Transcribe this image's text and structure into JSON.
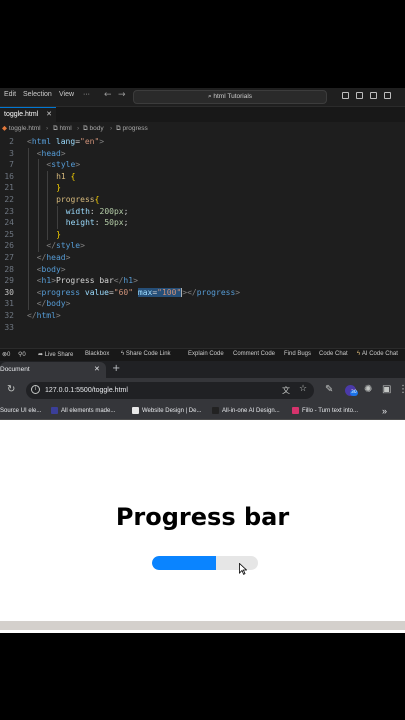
{
  "vscode": {
    "menu": [
      "Edit",
      "Selection",
      "View",
      "···"
    ],
    "search": "html Tutorials",
    "tab": {
      "filename": "toggle.html",
      "close": "✕"
    },
    "breadcrumb": [
      "toggle.html",
      "html",
      "body",
      "progress"
    ],
    "code_lines": [
      {
        "n": "2",
        "active": false,
        "indent": 0,
        "parts": [
          [
            "c-br",
            "<"
          ],
          [
            "c-tag",
            "html"
          ],
          [
            "c-txt",
            " "
          ],
          [
            "c-attr",
            "lang"
          ],
          [
            "c-txt",
            "="
          ],
          [
            "c-str",
            "\"en\""
          ],
          [
            "c-br",
            ">"
          ]
        ]
      },
      {
        "n": "3",
        "active": false,
        "indent": 1,
        "parts": [
          [
            "c-br",
            "<"
          ],
          [
            "c-tag",
            "head"
          ],
          [
            "c-br",
            ">"
          ]
        ]
      },
      {
        "n": "7",
        "active": false,
        "indent": 2,
        "parts": [
          [
            "c-br",
            "<"
          ],
          [
            "c-tag",
            "style"
          ],
          [
            "c-br",
            ">"
          ]
        ]
      },
      {
        "n": "16",
        "active": false,
        "indent": 3,
        "parts": [
          [
            "c-sel",
            "h1"
          ],
          [
            "c-txt",
            " "
          ],
          [
            "c-yellow",
            "{"
          ]
        ]
      },
      {
        "n": "21",
        "active": false,
        "indent": 3,
        "parts": [
          [
            "c-yellow",
            "}"
          ]
        ]
      },
      {
        "n": "22",
        "active": false,
        "indent": 3,
        "parts": [
          [
            "c-sel",
            "progress"
          ],
          [
            "c-yellow",
            "{"
          ]
        ]
      },
      {
        "n": "23",
        "active": false,
        "indent": 4,
        "parts": [
          [
            "c-prop",
            "width"
          ],
          [
            "c-txt",
            ": "
          ],
          [
            "c-num",
            "200px"
          ],
          [
            "c-txt",
            ";"
          ]
        ]
      },
      {
        "n": "24",
        "active": false,
        "indent": 4,
        "parts": [
          [
            "c-prop",
            "height"
          ],
          [
            "c-txt",
            ": "
          ],
          [
            "c-num",
            "50px"
          ],
          [
            "c-txt",
            ";"
          ]
        ]
      },
      {
        "n": "25",
        "active": false,
        "indent": 3,
        "parts": [
          [
            "c-yellow",
            "}"
          ]
        ]
      },
      {
        "n": "26",
        "active": false,
        "indent": 2,
        "parts": [
          [
            "c-br",
            "</"
          ],
          [
            "c-tag",
            "style"
          ],
          [
            "c-br",
            ">"
          ]
        ]
      },
      {
        "n": "27",
        "active": false,
        "indent": 1,
        "parts": [
          [
            "c-br",
            "</"
          ],
          [
            "c-tag",
            "head"
          ],
          [
            "c-br",
            ">"
          ]
        ]
      },
      {
        "n": "28",
        "active": false,
        "indent": 1,
        "parts": [
          [
            "c-br",
            "<"
          ],
          [
            "c-tag",
            "body"
          ],
          [
            "c-br",
            ">"
          ]
        ]
      },
      {
        "n": "29",
        "active": false,
        "indent": 1,
        "parts": [
          [
            "c-br",
            "<"
          ],
          [
            "c-tag",
            "h1"
          ],
          [
            "c-br",
            ">"
          ],
          [
            "c-txt",
            "Progress bar"
          ],
          [
            "c-br",
            "</"
          ],
          [
            "c-tag",
            "h1"
          ],
          [
            "c-br",
            ">"
          ]
        ]
      },
      {
        "n": "30",
        "active": true,
        "indent": 1,
        "parts": [
          [
            "c-br",
            "<"
          ],
          [
            "c-tag",
            "progress"
          ],
          [
            "c-txt",
            " "
          ],
          [
            "c-attr",
            "value"
          ],
          [
            "c-txt",
            "="
          ],
          [
            "c-str",
            "\"60\""
          ],
          [
            "c-txt",
            " "
          ],
          [
            "c-attr sel-hl",
            "max"
          ],
          [
            "c-txt sel-hl",
            "="
          ],
          [
            "c-str sel-hl",
            "\"100\""
          ],
          [
            "cursor",
            ""
          ],
          [
            "c-br",
            ">"
          ],
          [
            "c-br",
            "</"
          ],
          [
            "c-tag",
            "progress"
          ],
          [
            "c-br",
            ">"
          ]
        ]
      },
      {
        "n": "31",
        "active": false,
        "indent": 1,
        "parts": [
          [
            "c-br",
            "</"
          ],
          [
            "c-tag",
            "body"
          ],
          [
            "c-br",
            ">"
          ]
        ]
      },
      {
        "n": "32",
        "active": false,
        "indent": 0,
        "parts": [
          [
            "c-br",
            "</"
          ],
          [
            "c-tag",
            "html"
          ],
          [
            "c-br",
            ">"
          ]
        ]
      },
      {
        "n": "33",
        "active": false,
        "indent": 0,
        "parts": []
      }
    ],
    "status": {
      "errors": "0",
      "warnings": "0",
      "ports": "0",
      "live_share": "Live Share",
      "blackbox": "Blackbox",
      "share_code": "Share Code Link",
      "explain": "Explain Code",
      "comment": "Comment Code",
      "bugs": "Find Bugs",
      "chat": "Code Chat",
      "ai_chat": "AI Code Chat"
    }
  },
  "browser": {
    "tab_title": "Document",
    "tab_close": "✕",
    "new_tab": "+",
    "url": "127.0.0.1:5500/toggle.html",
    "extension_badge": "30",
    "bookmarks": [
      {
        "label": "Source UI ele...",
        "color": "#2b2b2b"
      },
      {
        "label": "All elements made...",
        "color": "#3b3f99"
      },
      {
        "label": "Website Design | De...",
        "color": "#e8e8e8"
      },
      {
        "label": "All-in-one AI Design...",
        "color": "#222222"
      },
      {
        "label": "Fillo - Turn text into...",
        "color": "#d6336c"
      }
    ],
    "bookmarks_more": "»",
    "page": {
      "heading": "Progress bar",
      "progress": {
        "value": 60,
        "max": 100
      }
    }
  },
  "colors": {
    "progress_fill": "#0a84ff",
    "progress_track": "#e6e6e6",
    "vscode_accent": "#0078d4"
  }
}
